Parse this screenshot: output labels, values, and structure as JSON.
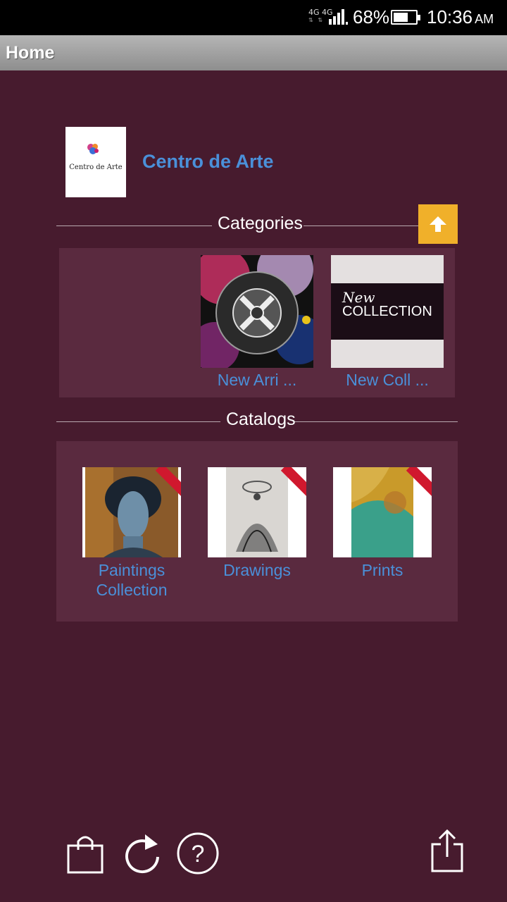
{
  "status_bar": {
    "network_label": "4G 4G",
    "battery_percent": "68%",
    "time": "10:36",
    "ampm": "AM"
  },
  "title_bar": {
    "title": "Home"
  },
  "store": {
    "name": "Centro de Arte",
    "logo_text": "Centro de Arte"
  },
  "categories": {
    "heading": "Categories",
    "items": [
      {
        "label": "New Arri ...",
        "image": "proud-to-vape-image"
      },
      {
        "label": "New Coll ...",
        "image": "new-collection-image",
        "image_text_1": "New",
        "image_text_2": "COLLECTION"
      }
    ]
  },
  "catalogs": {
    "heading": "Catalogs",
    "items": [
      {
        "label": "Paintings Collection",
        "image": "portrait-painting-image"
      },
      {
        "label": "Drawings",
        "image": "dervish-drawing-image"
      },
      {
        "label": "Prints",
        "image": "abstract-print-image"
      }
    ]
  },
  "bottom_bar": {
    "icons": [
      "shopping-bag-icon",
      "refresh-icon",
      "help-icon",
      "share-icon"
    ]
  },
  "colors": {
    "background": "#471b2e",
    "panel": "#5a2a3f",
    "accent_link": "#4a90d9",
    "scroll_up_button": "#f0b02a",
    "ribbon": "#d0182e"
  }
}
